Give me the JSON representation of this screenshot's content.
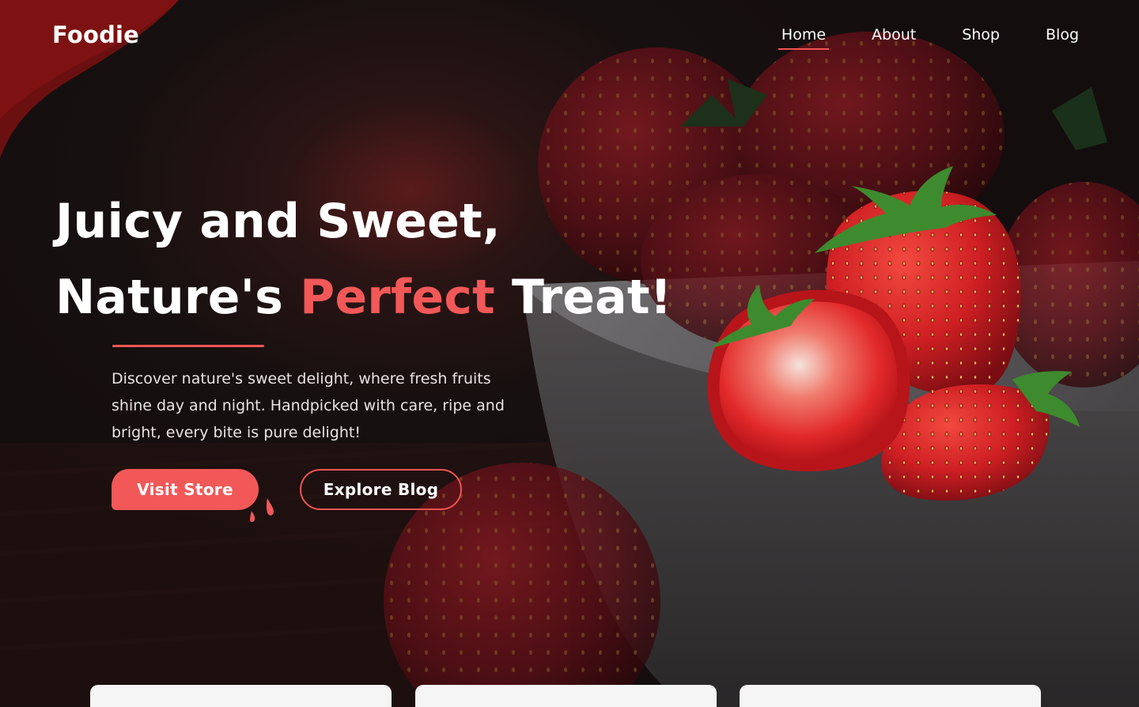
{
  "brand": {
    "name": "Foodie",
    "accent_color": "#f05454"
  },
  "nav": {
    "items": [
      {
        "label": "Home",
        "active": true
      },
      {
        "label": "About",
        "active": false
      },
      {
        "label": "Shop",
        "active": false
      },
      {
        "label": "Blog",
        "active": false
      }
    ]
  },
  "hero": {
    "line1": "Juicy and Sweet,",
    "line2_prefix": "Nature's ",
    "line2_accent": "Perfect",
    "line2_suffix": " Treat!",
    "description": "Discover nature's sweet delight, where fresh fruits shine day and night. Handpicked with care, ripe and bright, every bite is pure delight!",
    "primary_button": "Visit Store",
    "secondary_button": "Explore Blog",
    "image_subject": "strawberries-in-bowl"
  },
  "cards": [
    {
      "id": "card-1"
    },
    {
      "id": "card-2"
    },
    {
      "id": "card-3"
    }
  ]
}
